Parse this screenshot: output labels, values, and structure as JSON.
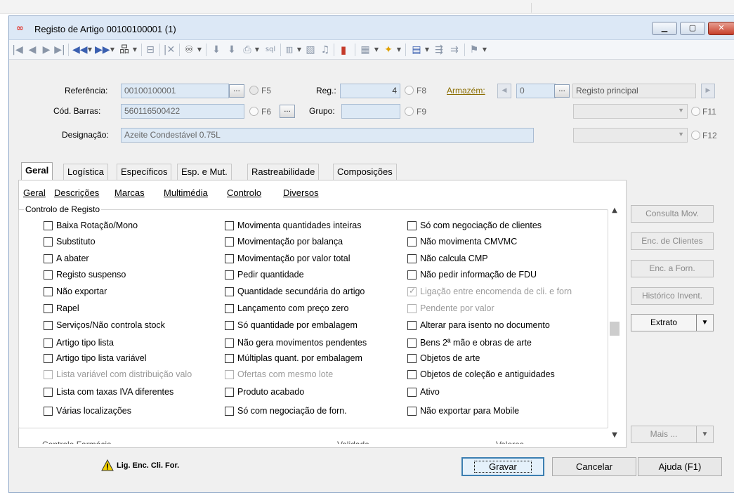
{
  "window": {
    "title": "Registo de Artigo 00100100001 (1)",
    "logo": "∞",
    "controls": {
      "minimize": "▁",
      "maximize": "▢",
      "close": "✕"
    }
  },
  "toolbar": {
    "icons": [
      "first-icon",
      "prev-icon",
      "next-icon",
      "last-icon",
      "prev-fast-icon",
      "next-fast-icon",
      "tree-icon",
      "layout-icon",
      "delete-icon",
      "binoculars-icon",
      "copy-icon",
      "paste-icon",
      "print-icon",
      "sql-icon",
      "barcode-icon",
      "image-icon",
      "attach-icon",
      "chart-icon",
      "calculator-icon",
      "wand-icon",
      "docs-icon",
      "flow-icon",
      "flag-icon"
    ]
  },
  "header": {
    "referencia_label": "Referência:",
    "referencia_value": "00100100001",
    "f5": "F5",
    "reg_label": "Reg.:",
    "reg_value": "4",
    "f8": "F8",
    "armazem_label": "Armazém:",
    "armazem_value": "0",
    "armazem_desc": "Registo principal",
    "cod_barras_label": "Cód. Barras:",
    "cod_barras_value": "560116500422",
    "f6": "F6",
    "grupo_label": "Grupo:",
    "grupo_value": "",
    "f9": "F9",
    "f11": "F11",
    "designacao_label": "Designação:",
    "designacao_value": "Azeite Condestável 0.75L",
    "f12": "F12",
    "ellipsis": "..."
  },
  "tabs": [
    "Geral",
    "Logística",
    "Específicos",
    "Esp. e Mut.",
    "Rastreabilidade",
    "Composições"
  ],
  "subtabs": [
    "Geral",
    "Descrições",
    "Marcas",
    "Multimédia",
    "Controlo",
    "Diversos"
  ],
  "group_title": "Controlo de Registo",
  "checkboxes": {
    "col1": [
      {
        "label": "Baixa Rotação/Mono"
      },
      {
        "label": "Substituto"
      },
      {
        "label": "A abater"
      },
      {
        "label": "Registo suspenso"
      },
      {
        "label": "Não exportar"
      },
      {
        "label": "Rapel"
      },
      {
        "label": "Serviços/Não controla stock"
      },
      {
        "label": "Artigo tipo lista"
      },
      {
        "label": "Artigo tipo lista variável"
      },
      {
        "label": "Lista variável com distribuição valo"
      },
      {
        "label": "Lista com taxas IVA diferentes"
      },
      {
        "label": "Várias localizações"
      }
    ],
    "col2": [
      {
        "label": "Movimenta quantidades inteiras"
      },
      {
        "label": "Movimentação por balança"
      },
      {
        "label": "Movimentação por valor total"
      },
      {
        "label": "Pedir quantidade"
      },
      {
        "label": "Quantidade secundária do artigo"
      },
      {
        "label": "Lançamento com preço zero"
      },
      {
        "label": "Só quantidade por embalagem"
      },
      {
        "label": "Não gera movimentos pendentes"
      },
      {
        "label": "Múltiplas quant. por embalagem"
      },
      {
        "label": "Ofertas com mesmo lote"
      },
      {
        "label": "Produto acabado"
      },
      {
        "label": "Só com negociação de forn."
      }
    ],
    "col3": [
      {
        "label": "Só com negociação de clientes"
      },
      {
        "label": "Não movimenta CMVMC"
      },
      {
        "label": "Não calcula CMP"
      },
      {
        "label": "Não pedir informação de FDU"
      },
      {
        "label": "Ligação entre encomenda de cli. e forn"
      },
      {
        "label": "Pendente por valor"
      },
      {
        "label": "Alterar para isento no documento"
      },
      {
        "label": "Bens 2ª mão e obras de arte"
      },
      {
        "label": "Objetos de arte"
      },
      {
        "label": "Objetos de coleção e antiguidades"
      },
      {
        "label": "Ativo"
      },
      {
        "label": "Não exportar para Mobile"
      }
    ]
  },
  "side_buttons": {
    "consulta": "Consulta Mov.",
    "enc_clientes": "Enc. de Clientes",
    "enc_forn": "Enc. a Forn.",
    "historico": "Histórico Invent.",
    "extrato": "Extrato",
    "mais": "Mais ..."
  },
  "cut_labels": [
    "Controlo Farmácia",
    "Validade",
    "Valores"
  ],
  "status": {
    "warning_label": "Lig. Enc. Cli. For."
  },
  "buttons": {
    "gravar": "Gravar",
    "cancelar": "Cancelar",
    "ajuda": "Ajuda (F1)"
  },
  "colors": {
    "titlebar": "#dce8f6",
    "field_bg": "#dde9f5",
    "link": "#8a6d00",
    "primary_border": "#3c7fb1"
  }
}
